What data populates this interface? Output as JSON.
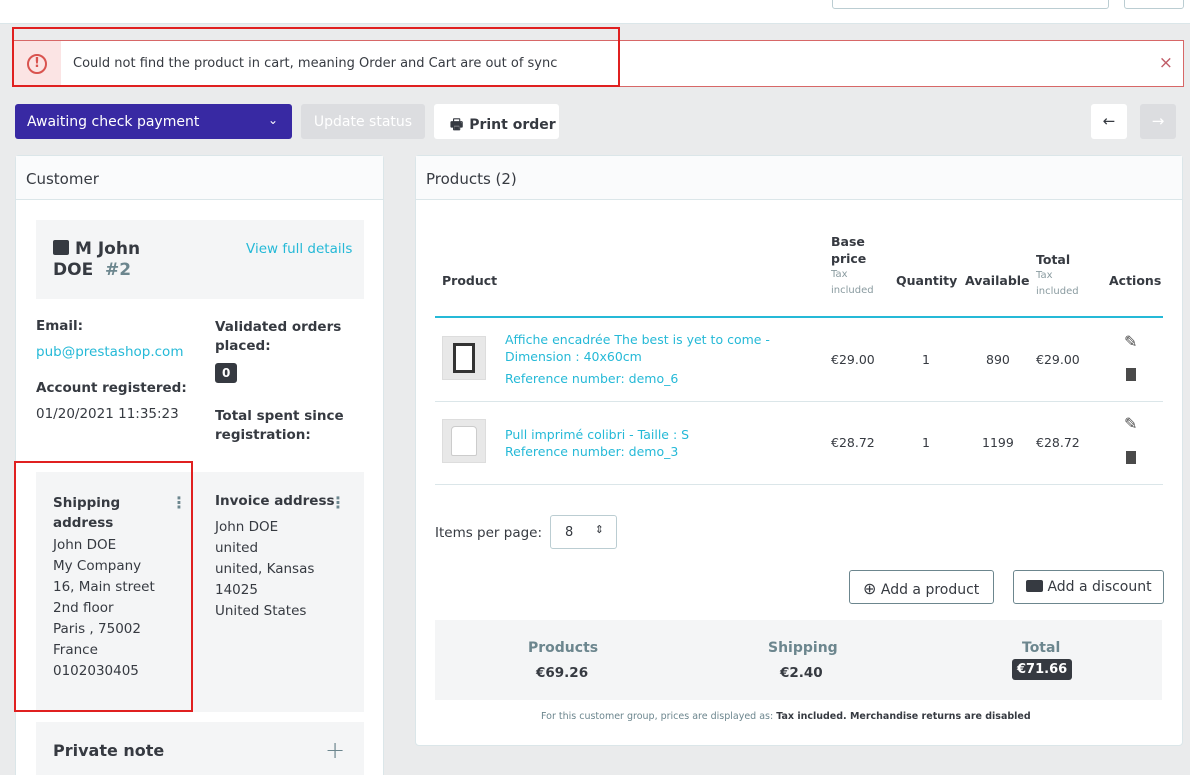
{
  "alert": {
    "message": "Could not find the product in cart, meaning Order and Cart are out of sync",
    "icon": "exclamation-circle-icon",
    "close_icon": "×"
  },
  "toolbar": {
    "status_value": "Awaiting check payment",
    "update_label": "Update status",
    "print_label": "Print order",
    "prev_icon": "←",
    "next_icon": "→"
  },
  "customer": {
    "header": "Customer",
    "name_line1": "M John",
    "name_line2": "DOE",
    "id": "#2",
    "view_details": "View full details",
    "email_label": "Email:",
    "email": "pub@prestashop.com",
    "account_label": "Account registered:",
    "account_date": "01/20/2021 11:35:23",
    "validated_label": "Validated orders placed:",
    "validated_count": "0",
    "spent_label": "Total spent since registration:",
    "shipping": {
      "title": "Shipping address",
      "lines": [
        "John DOE",
        "My Company",
        "16, Main street",
        "2nd floor",
        "Paris , 75002",
        "France",
        "0102030405"
      ]
    },
    "invoice": {
      "title": "Invoice address",
      "lines": [
        "John DOE",
        "united",
        "united, Kansas",
        "14025",
        "United States"
      ]
    },
    "private_note": "Private note",
    "plus_icon": "+"
  },
  "products": {
    "header": "Products (2)",
    "columns": {
      "product": "Product",
      "base_price": "Base price",
      "base_price_sub": "Tax included",
      "quantity": "Quantity",
      "available": "Available",
      "total": "Total",
      "total_sub": "Tax included",
      "actions": "Actions"
    },
    "rows": [
      {
        "name": "Affiche encadrée The best is yet to come - Dimension : 40x60cm",
        "reference": "Reference number: demo_6",
        "price": "€29.00",
        "qty": "1",
        "available": "890",
        "total": "€29.00"
      },
      {
        "name": "Pull imprimé colibri - Taille : S",
        "reference": "Reference number: demo_3",
        "price": "€28.72",
        "qty": "1",
        "available": "1199",
        "total": "€28.72"
      }
    ],
    "items_per_page_label": "Items per page:",
    "items_per_page_value": "8",
    "add_product": "Add a product",
    "add_discount": "Add a discount",
    "summary": {
      "products_label": "Products",
      "products_value": "€69.26",
      "shipping_label": "Shipping",
      "shipping_value": "€2.40",
      "total_label": "Total",
      "total_value": "€71.66"
    },
    "footnote_prefix": "For this customer group, prices are displayed as: ",
    "footnote_bold": "Tax included. Merchandise returns are disabled"
  }
}
